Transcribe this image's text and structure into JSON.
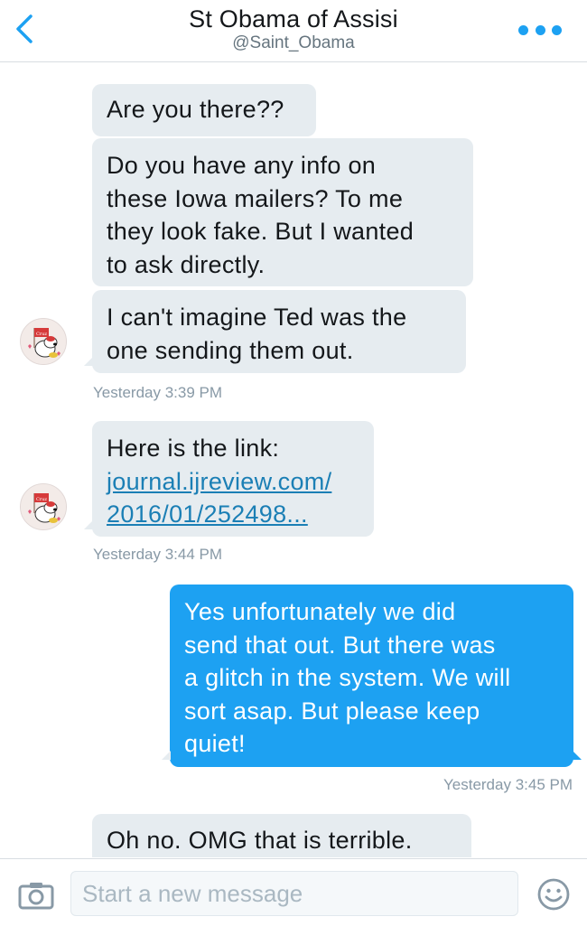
{
  "header": {
    "title": "St Obama of Assisi",
    "handle": "@Saint_Obama"
  },
  "messages": [
    {
      "direction": "incoming",
      "lines": [
        "Are you there??"
      ]
    },
    {
      "direction": "incoming",
      "lines": [
        "Do you have any info on",
        "these Iowa mailers? To me",
        "they look fake. But I wanted",
        "to ask directly."
      ]
    },
    {
      "direction": "incoming",
      "lines": [
        "I can't imagine Ted was the",
        "one sending them out."
      ]
    },
    {
      "direction": "incoming",
      "lines": [
        "Here is the link:"
      ],
      "link_lines": [
        "journal.ijreview.com/",
        "2016/01/252498..."
      ]
    },
    {
      "direction": "outgoing",
      "lines": [
        "Yes unfortunately we did",
        "send that out. But there was",
        "a glitch in the system. We will",
        "sort asap. But please keep",
        "quiet!"
      ]
    },
    {
      "direction": "incoming",
      "lines": [
        "Oh no. OMG that is terrible."
      ]
    }
  ],
  "timestamps": [
    "Yesterday 3:39 PM",
    "Yesterday 3:44 PM",
    "Yesterday 3:45 PM"
  ],
  "composer": {
    "placeholder": "Start a new message"
  },
  "icons": {
    "back": "chevron-left-icon",
    "more": "more-dots-icon",
    "camera": "camera-icon",
    "emoji": "smiley-icon",
    "avatar": "snoopy-cruz-avatar"
  },
  "colors": {
    "accent": "#1da1f2",
    "incoming_bubble": "#e6ecf0",
    "link": "#1b7fb5",
    "timestamp": "#8899a6"
  }
}
